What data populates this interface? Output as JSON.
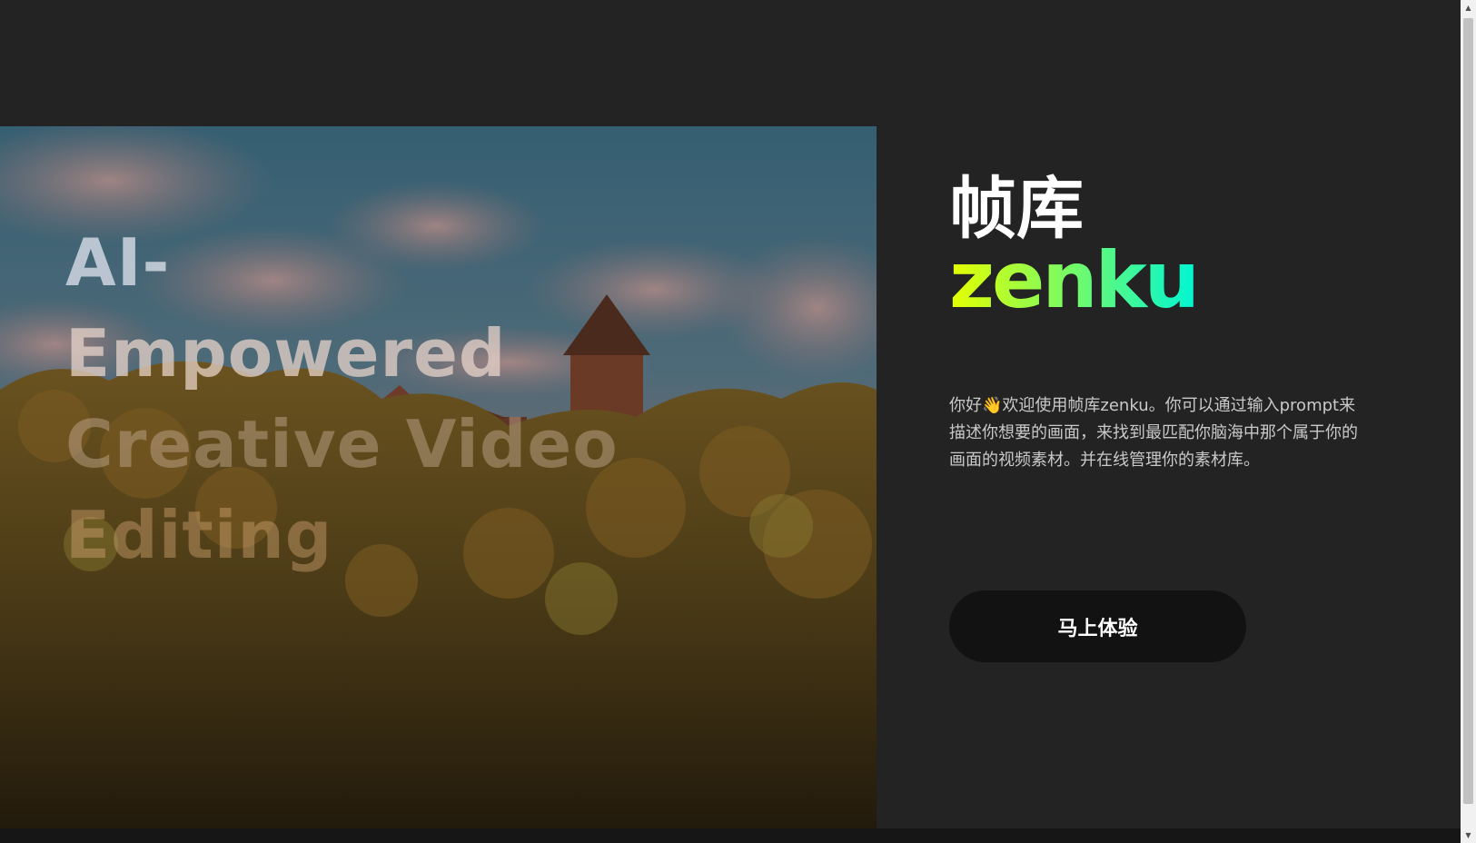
{
  "hero": {
    "headline_lines": [
      "AI-",
      "Empowered",
      "Creative Video",
      "Editing"
    ]
  },
  "brand": {
    "name_cn": "帧库",
    "logo_text": "zenku",
    "logo_gradient": [
      "#e6ff00",
      "#00f5d4"
    ]
  },
  "intro": {
    "text": "你好👋欢迎使用帧库zenku。你可以通过输入prompt来描述你想要的画面，来找到最匹配你脑海中那个属于你的画面的视频素材。并在线管理你的素材库。"
  },
  "cta": {
    "label": "马上体验"
  },
  "colors": {
    "page_bg": "#232323",
    "button_bg": "#121212",
    "text_muted": "#c9c9c9"
  }
}
